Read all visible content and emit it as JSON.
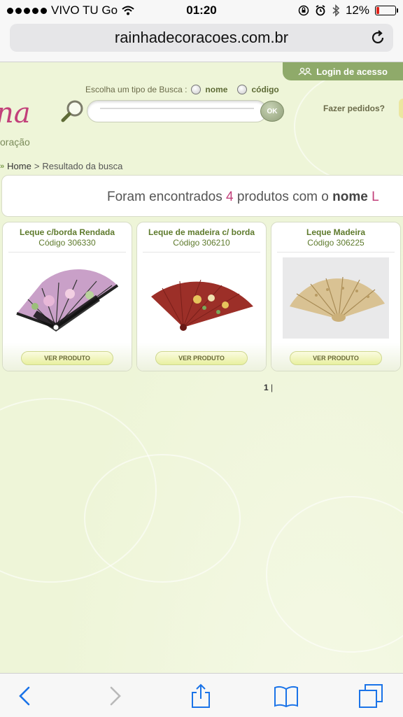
{
  "status_bar": {
    "carrier": "VIVO TU Go",
    "time": "01:20",
    "battery": "12%"
  },
  "address_bar": {
    "url": "rainhadecoracoes.com.br"
  },
  "header": {
    "login_label": "Login de acesso",
    "logo_text_top": "na",
    "logo_text_bottom": "oração",
    "search_type_label": "Escolha um tipo de Busca :",
    "radio_nome": "nome",
    "radio_codigo": "código",
    "ok_label": "OK",
    "fazer_pedidos": "Fazer pedidos?"
  },
  "breadcrumb": {
    "arrow": "»",
    "home": "Home",
    "separator": ">",
    "current": "Resultado da busca"
  },
  "results": {
    "prefix": "Foram encontrados",
    "count": "4",
    "middle": "produtos com o",
    "field": "nome",
    "term": "L"
  },
  "products": [
    {
      "name": "Leque c/borda Rendada",
      "code": "Código 306330",
      "button": "VER PRODUTO"
    },
    {
      "name": "Leque de madeira c/ borda",
      "code": "Código 306210",
      "button": "VER PRODUTO"
    },
    {
      "name": "Leque Madeira",
      "code": "Código 306225",
      "button": "VER PRODUTO"
    }
  ],
  "pagination": {
    "current": "1",
    "separator": "|"
  },
  "colors": {
    "background": "#eef5d8",
    "accent_green": "#8faa6a",
    "accent_pink": "#c2407a"
  }
}
